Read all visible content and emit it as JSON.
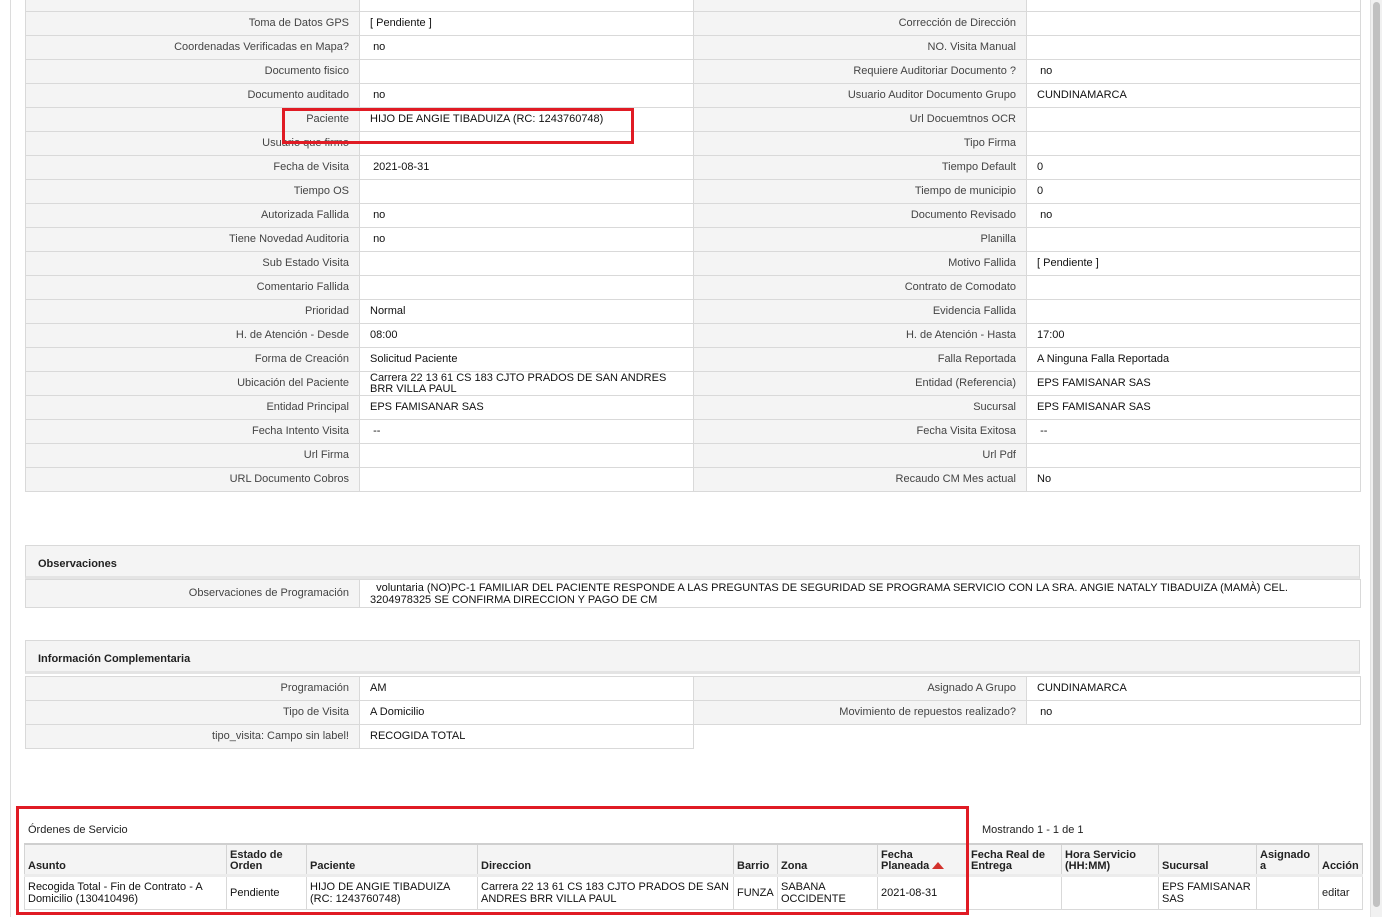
{
  "details_top": {
    "rows": [
      [
        "Toma de Datos GPS",
        "[ Pendiente ]",
        "Corrección de Dirección",
        ""
      ],
      [
        "Coordenadas Verificadas en Mapa?",
        " no",
        "NO. Visita Manual",
        ""
      ],
      [
        "Documento fisico",
        "",
        "Requiere Auditoriar Documento ?",
        " no"
      ],
      [
        "Documento auditado",
        " no",
        "Usuario Auditor Documento Grupo",
        "CUNDINAMARCA"
      ],
      [
        "Paciente",
        "HIJO DE ANGIE TIBADUIZA (RC: 1243760748)",
        "Url Docuemtnos OCR",
        ""
      ],
      [
        "Usuario que firmo",
        "",
        "Tipo Firma",
        ""
      ],
      [
        "Fecha de Visita",
        " 2021-08-31",
        "Tiempo Default",
        "0"
      ],
      [
        "Tiempo OS",
        "",
        "Tiempo de municipio",
        "0"
      ],
      [
        "Autorizada Fallida",
        " no",
        "Documento Revisado",
        " no"
      ],
      [
        "Tiene Novedad Auditoria",
        " no",
        "Planilla",
        ""
      ],
      [
        "Sub Estado Visita",
        "",
        "Motivo Fallida",
        "[ Pendiente ]"
      ],
      [
        "Comentario Fallida",
        "",
        "Contrato de Comodato",
        ""
      ],
      [
        "Prioridad",
        "Normal",
        "Evidencia Fallida",
        ""
      ],
      [
        "H. de Atención - Desde",
        "08:00",
        "H. de Atención - Hasta",
        "17:00"
      ],
      [
        "Forma de Creación",
        "Solicitud Paciente",
        "Falla Reportada",
        "A Ninguna Falla Reportada"
      ],
      [
        "Ubicación del Paciente",
        "Carrera 22 13 61 CS 183 CJTO PRADOS DE SAN ANDRES BRR VILLA PAUL",
        "Entidad (Referencia)",
        "EPS FAMISANAR SAS"
      ],
      [
        "Entidad Principal",
        "EPS FAMISANAR SAS",
        "Sucursal",
        "EPS FAMISANAR SAS"
      ],
      [
        "Fecha Intento Visita",
        " --",
        "Fecha Visita Exitosa",
        " --"
      ],
      [
        "Url Firma",
        "",
        "Url Pdf",
        ""
      ],
      [
        "URL Documento Cobros",
        "",
        "Recaudo CM Mes actual",
        "No"
      ]
    ]
  },
  "observaciones": {
    "title": "Observaciones",
    "label": "Observaciones de Programación",
    "value": "  voluntaria (NO)PC-1 FAMILIAR DEL PACIENTE RESPONDE A LAS PREGUNTAS DE SEGURIDAD SE PROGRAMA SERVICIO CON LA SRA. ANGIE NATALY TIBADUIZA (MAMÀ) CEL. 3204978325 SE CONFIRMA DIRECCION Y PAGO DE CM"
  },
  "info_complementaria": {
    "title": "Información Complementaria",
    "rows": [
      [
        "Programación",
        "AM",
        "Asignado A Grupo",
        "CUNDINAMARCA"
      ],
      [
        "Tipo de Visita",
        "A Domicilio",
        "Movimiento de repuestos realizado?",
        " no"
      ],
      [
        "tipo_visita: Campo sin label!",
        "RECOGIDA TOTAL",
        null,
        null
      ]
    ]
  },
  "orders": {
    "title": "Órdenes de Servicio",
    "count_text": "Mostrando 1 - 1 de 1",
    "columns": [
      "Asunto",
      "Estado de Orden",
      "Paciente",
      "Direccion",
      "Barrio",
      "Zona",
      "Fecha Planeada",
      "Fecha Real de Entrega",
      "Hora Servicio (HH:MM)",
      "Sucursal",
      "Asignado a",
      "Acción"
    ],
    "sort_icon": "sort-ascending-icon",
    "rows": [
      [
        "Recogida Total - Fin de Contrato - A Domicilio (130410496)",
        "Pendiente",
        "HIJO DE ANGIE TIBADUIZA (RC: 1243760748)",
        "Carrera 22 13 61 CS 183 CJTO PRADOS DE SAN ANDRES BRR VILLA PAUL",
        "FUNZA",
        "SABANA OCCIDENTE",
        "2021-08-31",
        "",
        "",
        "EPS FAMISANAR SAS",
        "",
        "editar"
      ]
    ]
  },
  "colors": {
    "highlight": "#e01b24",
    "label_bg": "#f4f4f4",
    "border": "#d9d9d9",
    "sort_arrow": "#d2322d"
  }
}
